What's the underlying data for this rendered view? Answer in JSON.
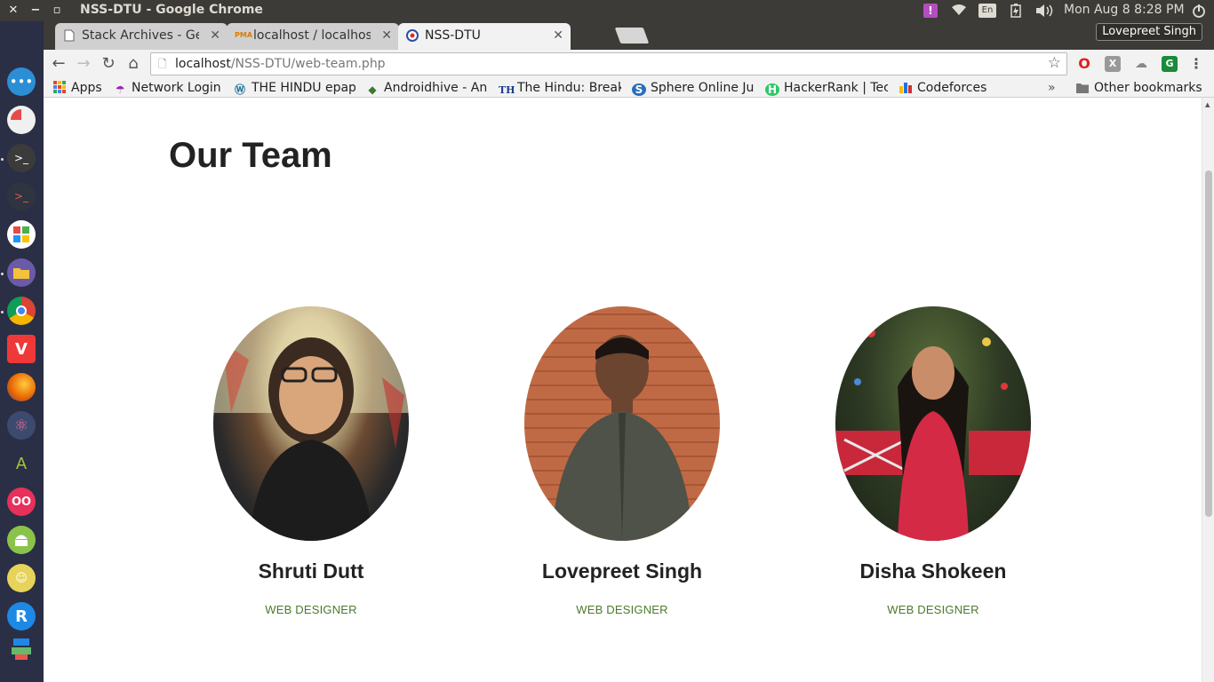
{
  "os": {
    "window_title": "NSS-DTU - Google Chrome",
    "keyboard_layout": "En",
    "clock": "Mon Aug  8  8:28 PM"
  },
  "browser": {
    "tabs": [
      {
        "label": "Stack Archives - Gee",
        "favicon": "page-icon"
      },
      {
        "label": "localhost / localhos",
        "favicon": "phpmyadmin-icon"
      },
      {
        "label": "NSS-DTU",
        "favicon": "nss-logo-icon"
      }
    ],
    "profile_name": "Lovepreet Singh",
    "url_host": "localhost",
    "url_path": "/NSS-DTU/web-team.php",
    "bookmarks": [
      {
        "label": "Apps",
        "icon": "apps-grid-icon"
      },
      {
        "label": "Network Login",
        "icon": "umbrella-icon"
      },
      {
        "label": "THE HINDU epap",
        "icon": "wordpress-icon"
      },
      {
        "label": "Androidhive - An",
        "icon": "androidhive-icon"
      },
      {
        "label": "The Hindu: Break",
        "icon": "thehindu-icon"
      },
      {
        "label": "Sphere Online Ju",
        "icon": "spoj-icon"
      },
      {
        "label": "HackerRank | Tec",
        "icon": "hackerrank-icon"
      },
      {
        "label": "Codeforces",
        "icon": "codeforces-icon"
      }
    ],
    "bookmarks_overflow": "»",
    "other_bookmarks": "Other bookmarks"
  },
  "page": {
    "title": "Our Team",
    "members": [
      {
        "name": "Shruti Dutt",
        "role": "WEB DESIGNER"
      },
      {
        "name": "Lovepreet Singh",
        "role": "WEB DESIGNER"
      },
      {
        "name": "Disha Shokeen",
        "role": "WEB DESIGNER"
      }
    ]
  },
  "colors": {
    "role_text": "#4a7a2a",
    "launcher_bg": "#2a2f45",
    "topbar_bg": "#3c3b37"
  }
}
